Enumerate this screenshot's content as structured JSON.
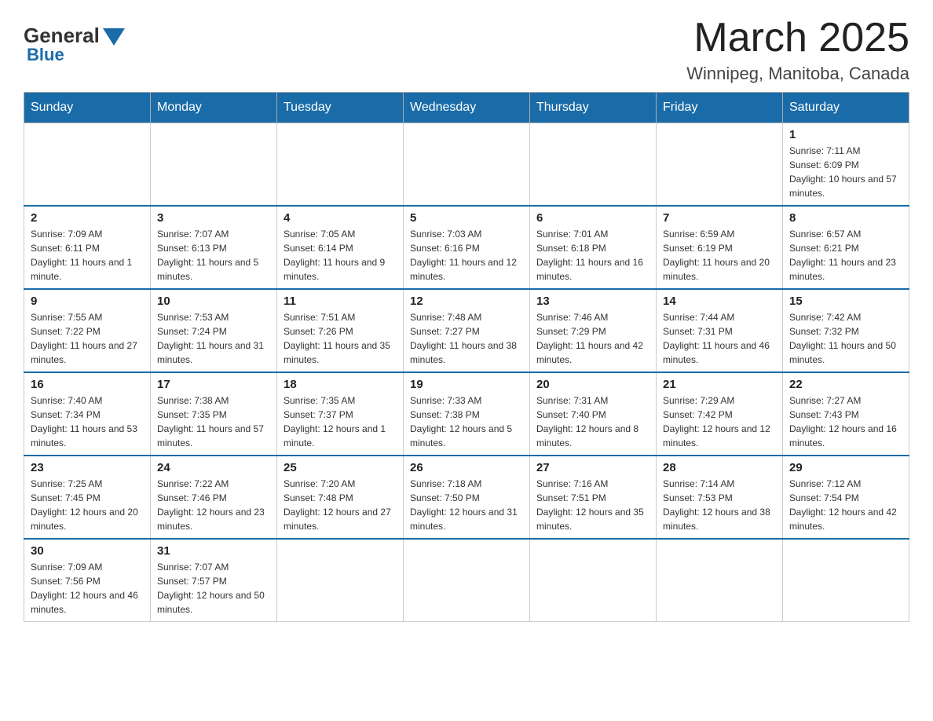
{
  "header": {
    "logo_general": "General",
    "logo_blue": "Blue",
    "month": "March 2025",
    "location": "Winnipeg, Manitoba, Canada"
  },
  "weekdays": [
    "Sunday",
    "Monday",
    "Tuesday",
    "Wednesday",
    "Thursday",
    "Friday",
    "Saturday"
  ],
  "weeks": [
    [
      {
        "num": "",
        "info": ""
      },
      {
        "num": "",
        "info": ""
      },
      {
        "num": "",
        "info": ""
      },
      {
        "num": "",
        "info": ""
      },
      {
        "num": "",
        "info": ""
      },
      {
        "num": "",
        "info": ""
      },
      {
        "num": "1",
        "info": "Sunrise: 7:11 AM\nSunset: 6:09 PM\nDaylight: 10 hours and 57 minutes."
      }
    ],
    [
      {
        "num": "2",
        "info": "Sunrise: 7:09 AM\nSunset: 6:11 PM\nDaylight: 11 hours and 1 minute."
      },
      {
        "num": "3",
        "info": "Sunrise: 7:07 AM\nSunset: 6:13 PM\nDaylight: 11 hours and 5 minutes."
      },
      {
        "num": "4",
        "info": "Sunrise: 7:05 AM\nSunset: 6:14 PM\nDaylight: 11 hours and 9 minutes."
      },
      {
        "num": "5",
        "info": "Sunrise: 7:03 AM\nSunset: 6:16 PM\nDaylight: 11 hours and 12 minutes."
      },
      {
        "num": "6",
        "info": "Sunrise: 7:01 AM\nSunset: 6:18 PM\nDaylight: 11 hours and 16 minutes."
      },
      {
        "num": "7",
        "info": "Sunrise: 6:59 AM\nSunset: 6:19 PM\nDaylight: 11 hours and 20 minutes."
      },
      {
        "num": "8",
        "info": "Sunrise: 6:57 AM\nSunset: 6:21 PM\nDaylight: 11 hours and 23 minutes."
      }
    ],
    [
      {
        "num": "9",
        "info": "Sunrise: 7:55 AM\nSunset: 7:22 PM\nDaylight: 11 hours and 27 minutes."
      },
      {
        "num": "10",
        "info": "Sunrise: 7:53 AM\nSunset: 7:24 PM\nDaylight: 11 hours and 31 minutes."
      },
      {
        "num": "11",
        "info": "Sunrise: 7:51 AM\nSunset: 7:26 PM\nDaylight: 11 hours and 35 minutes."
      },
      {
        "num": "12",
        "info": "Sunrise: 7:48 AM\nSunset: 7:27 PM\nDaylight: 11 hours and 38 minutes."
      },
      {
        "num": "13",
        "info": "Sunrise: 7:46 AM\nSunset: 7:29 PM\nDaylight: 11 hours and 42 minutes."
      },
      {
        "num": "14",
        "info": "Sunrise: 7:44 AM\nSunset: 7:31 PM\nDaylight: 11 hours and 46 minutes."
      },
      {
        "num": "15",
        "info": "Sunrise: 7:42 AM\nSunset: 7:32 PM\nDaylight: 11 hours and 50 minutes."
      }
    ],
    [
      {
        "num": "16",
        "info": "Sunrise: 7:40 AM\nSunset: 7:34 PM\nDaylight: 11 hours and 53 minutes."
      },
      {
        "num": "17",
        "info": "Sunrise: 7:38 AM\nSunset: 7:35 PM\nDaylight: 11 hours and 57 minutes."
      },
      {
        "num": "18",
        "info": "Sunrise: 7:35 AM\nSunset: 7:37 PM\nDaylight: 12 hours and 1 minute."
      },
      {
        "num": "19",
        "info": "Sunrise: 7:33 AM\nSunset: 7:38 PM\nDaylight: 12 hours and 5 minutes."
      },
      {
        "num": "20",
        "info": "Sunrise: 7:31 AM\nSunset: 7:40 PM\nDaylight: 12 hours and 8 minutes."
      },
      {
        "num": "21",
        "info": "Sunrise: 7:29 AM\nSunset: 7:42 PM\nDaylight: 12 hours and 12 minutes."
      },
      {
        "num": "22",
        "info": "Sunrise: 7:27 AM\nSunset: 7:43 PM\nDaylight: 12 hours and 16 minutes."
      }
    ],
    [
      {
        "num": "23",
        "info": "Sunrise: 7:25 AM\nSunset: 7:45 PM\nDaylight: 12 hours and 20 minutes."
      },
      {
        "num": "24",
        "info": "Sunrise: 7:22 AM\nSunset: 7:46 PM\nDaylight: 12 hours and 23 minutes."
      },
      {
        "num": "25",
        "info": "Sunrise: 7:20 AM\nSunset: 7:48 PM\nDaylight: 12 hours and 27 minutes."
      },
      {
        "num": "26",
        "info": "Sunrise: 7:18 AM\nSunset: 7:50 PM\nDaylight: 12 hours and 31 minutes."
      },
      {
        "num": "27",
        "info": "Sunrise: 7:16 AM\nSunset: 7:51 PM\nDaylight: 12 hours and 35 minutes."
      },
      {
        "num": "28",
        "info": "Sunrise: 7:14 AM\nSunset: 7:53 PM\nDaylight: 12 hours and 38 minutes."
      },
      {
        "num": "29",
        "info": "Sunrise: 7:12 AM\nSunset: 7:54 PM\nDaylight: 12 hours and 42 minutes."
      }
    ],
    [
      {
        "num": "30",
        "info": "Sunrise: 7:09 AM\nSunset: 7:56 PM\nDaylight: 12 hours and 46 minutes."
      },
      {
        "num": "31",
        "info": "Sunrise: 7:07 AM\nSunset: 7:57 PM\nDaylight: 12 hours and 50 minutes."
      },
      {
        "num": "",
        "info": ""
      },
      {
        "num": "",
        "info": ""
      },
      {
        "num": "",
        "info": ""
      },
      {
        "num": "",
        "info": ""
      },
      {
        "num": "",
        "info": ""
      }
    ]
  ]
}
